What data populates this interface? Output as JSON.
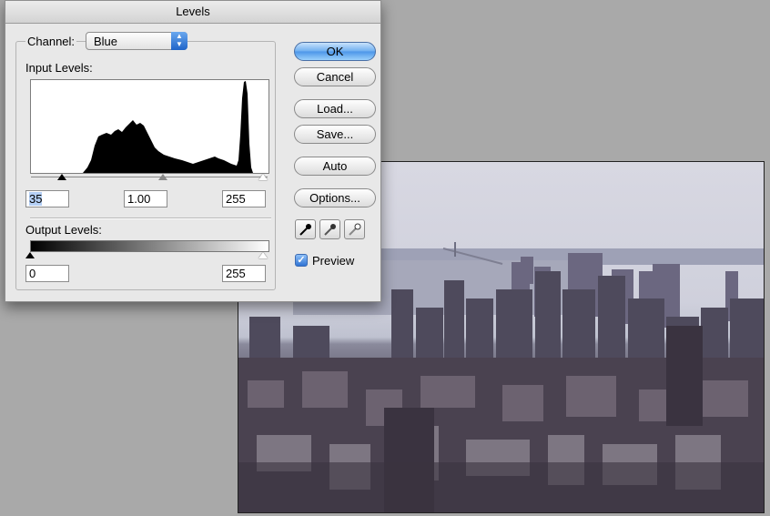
{
  "dialog": {
    "title": "Levels",
    "channel_label": "Channel:",
    "channel_value": "Blue",
    "input_levels_label": "Input Levels:",
    "input_black": "35",
    "input_gamma": "1.00",
    "input_white": "255",
    "output_levels_label": "Output Levels:",
    "output_black": "0",
    "output_white": "255",
    "buttons": {
      "ok": "OK",
      "cancel": "Cancel",
      "load": "Load...",
      "save": "Save...",
      "auto": "Auto",
      "options": "Options..."
    },
    "eyedroppers": [
      "black-point-eyedropper-icon",
      "gray-point-eyedropper-icon",
      "white-point-eyedropper-icon"
    ],
    "preview_label": "Preview",
    "preview_checked": true
  },
  "colors": {
    "default_button": "#4b95e8",
    "dialog_bg": "#e8e8e8",
    "workspace_bg": "#a9a9a9"
  }
}
